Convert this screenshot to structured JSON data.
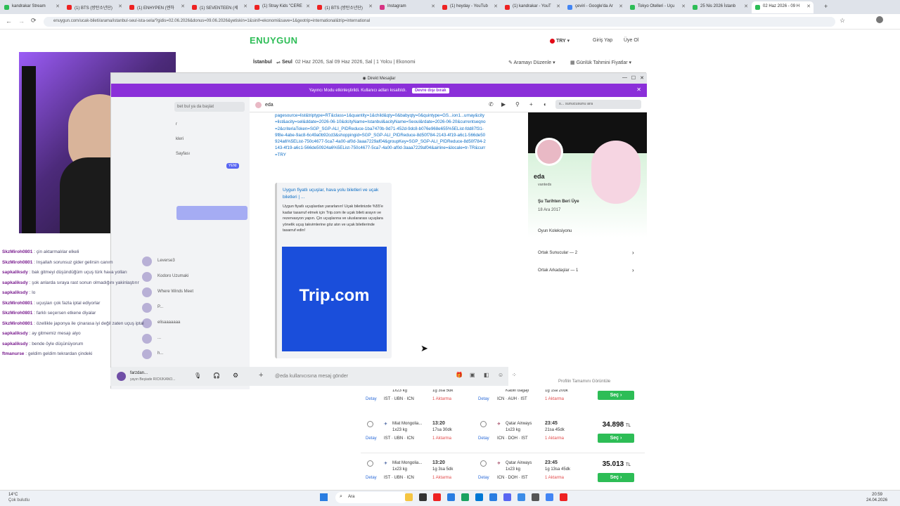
{
  "browser": {
    "tabs": [
      {
        "label": "kandrakar Stream",
        "color": "#2dbd56"
      },
      {
        "label": "(1) BTS (방탄소년단)",
        "color": "#e22"
      },
      {
        "label": "(1) ENHYPEN (엔하",
        "color": "#e22"
      },
      {
        "label": "(1) SEVENTEEN (세",
        "color": "#e22"
      },
      {
        "label": "(1) Stray Kids \"CERE",
        "color": "#e22"
      },
      {
        "label": "(1) BTS (방탄소년단)",
        "color": "#e22"
      },
      {
        "label": "Instagram",
        "color": "#d63384"
      },
      {
        "label": "(1) heyday - YouTub",
        "color": "#e22"
      },
      {
        "label": "(1) kandrakar - YouT",
        "color": "#e22"
      },
      {
        "label": "çeviri - Google'da Ar",
        "color": "#4285f4"
      },
      {
        "label": "Tokyo Otelleri - Uçu",
        "color": "#2dbd56"
      },
      {
        "label": "25 Nis 2026 İstanb",
        "color": "#2dbd56"
      },
      {
        "label": "02 Haz 2026 - 09 H",
        "color": "#2dbd56"
      }
    ],
    "url": "enuygun.com/ucak-bileti/arama/istanbul-seul-ista-sela/?gidis=02.06.2026&donus=09.06.2026&yetiskin=1&sinif=ekonomi&save=1&geotrip=international&trip=international"
  },
  "site": {
    "logo": "ENUYGUN",
    "currency": "TRY",
    "login": "Giriş Yap",
    "signup": "Üye Ol",
    "summary_from": "İstanbul",
    "summary_to": "Seul",
    "summary_details": "02 Haz 2026, Sal 09 Haz 2026, Sal | 1 Yolcu | Ekonomi",
    "edit_search": "Aramayı Düzenle",
    "daily_prices": "Günlük Tahmini Fiyatlar",
    "flights": [
      {
        "airline": "",
        "time": "",
        "bag": "1x23 kg",
        "duration": "1g 3sa 5dk",
        "route": "IST · UBN · ICN",
        "stops": "1 Aktarma",
        "ret_airline": "",
        "ret_time": "",
        "ret_bag": "Kabin bagajı",
        "ret_duration": "1g 1sa 20dk",
        "ret_route": "ICN · AUH · IST",
        "ret_stops": "1 Aktarma",
        "price": "",
        "btn": "Seç"
      },
      {
        "airline": "Miat Mongolia...",
        "time": "13:20",
        "bag": "1x23 kg",
        "duration": "17sa 30dk",
        "route": "IST · UBN · ICN",
        "stops": "1 Aktarma",
        "ret_airline": "Qatar Airways",
        "ret_time": "23:45",
        "ret_bag": "1x23 kg",
        "ret_duration": "21sa 45dk",
        "ret_route": "ICN · DOH · IST",
        "ret_stops": "1 Aktarma",
        "price": "34.898",
        "btn": "Seç"
      },
      {
        "airline": "Miat Mongolia...",
        "time": "13:20",
        "bag": "1x23 kg",
        "duration": "1g 3sa 5dk",
        "route": "IST · UBN · ICN",
        "stops": "1 Aktarma",
        "ret_airline": "Qatar Airways",
        "ret_time": "23:45",
        "ret_bag": "1x23 kg",
        "ret_duration": "1g 13sa 45dk",
        "ret_route": "ICN · DOH · IST",
        "ret_stops": "1 Aktarma",
        "price": "35.013",
        "btn": "Seç"
      }
    ],
    "detail_link": "Detay",
    "currency_suffix": "TL"
  },
  "discord": {
    "window_title": "Direkt Mesajlar",
    "banner_text": "Yayıncı Modu etkinleştirildi. Kullanıcı adları kısaltıldı.",
    "banner_button": "Devre dışı bırak",
    "dm_search": "bet bul ya da başlat",
    "new_badge": "YENİ",
    "dm_items": [
      "r",
      "kleri",
      "Sayfası",
      "Leverse3",
      "Kodoro Uzumaki",
      "Where Winds Meet",
      "P...",
      "elisaaaaaaa",
      "...",
      "h..."
    ],
    "channel_user": "eda",
    "search_placeholder": "s... sunucusunu ara",
    "link_text": "pagesource=list&triptype=RT&class=1&quantity=1&child&qty=0&babyqty=0&quintype=GS...ion1...urnay&city=list&acity=sel&ddate=2026-06-10&dcityName=Istanbul&acityName=Seoul&rdate=2026-06-20&currentseqno=2&criteriaToken=SGP_SGP-ALI_PIDReduce-1ba7470b-9d71-452d-9dc8-b076e968e655%5EList-fdd87f31-9f8e-4abe-9ac8-6c49a0b92cd3&shoppingid=SGP_SGP-ALI_PIDReduce-8d50f784-2143-4f19-a6c1-566de50924a6%5EList-750c4677-5ca7-4a00-af0d-3aaa7229af04&groupKey=SGP_SGP-ALI_PIDReduce-8d50f784-2143-4f19-a6c1-566de50924a6%5EList-750c4677-5ca7-4a00-af0d-3aaa7229af04&airline=&locale=tr-TR&curr=TRY",
    "embed_title": "Uygun fiyatlı uçuşlar, hava yolu biletleri ve uçak biletleri | ...",
    "embed_desc": "Uygun fiyatlı uçuşlardan yararlanın! Uçak biletinizde %55'e kadar tasarruf etmek için Trip.com ile uçak bileti arayın ve rezervasyon yapın. Çin uçuşlarına ve uluslararası uçuşlara yönelik uçuş takvimlerine göz atın ve uçak biletlerinde tasarruf edin!",
    "embed_brand": "Trip.com",
    "message_placeholder": "@eda kullanıcısına mesaj gönder",
    "profile": {
      "name": "eda",
      "status": "vanteds",
      "member_since_label": "Şu Tarihten Beri Üye",
      "member_since": "18 Ara 2017",
      "collection": "Oyun Koleksiyonu",
      "mutual_servers": "Ortak Sunucular — 2",
      "mutual_friends": "Ortak Arkadaşlar — 1",
      "view_full": "Profilin Tamamını Görüntüle"
    },
    "voice_user": "farzdan...",
    "voice_status": "yayın Beşiade RICK/KANO..."
  },
  "overlay_chat": [
    {
      "user": "SkzMiroh0801",
      "text": ": çin aktarmalılar elkeli"
    },
    {
      "user": "SkzMiroh0801",
      "text": ": Inşallah sorunsuz gider gelirsin canım"
    },
    {
      "user": "sapkaliksdy",
      "text": ": bak gitmeyi düşündüğüm uçuş türk hava yolları"
    },
    {
      "user": "sapkaliksdy",
      "text": ": şok anlarda sıraya rast sonun olmadığını yakinlaştırır"
    },
    {
      "user": "sapkaliksdy",
      "text": ": lo"
    },
    {
      "user": "SkzMiroh0801",
      "text": ": uçuşları çok fazla iptal ediyorlar"
    },
    {
      "user": "SkzMiroh0801",
      "text": ": farklı seçersen etkene diyalar"
    },
    {
      "user": "SkzMiroh0801",
      "text": ": özellikle japonya ile çinarasa iyi değil zaten uçuş iptal"
    },
    {
      "user": "sapkaliksdy",
      "text": ": ay gitmemiz mesajı alyo"
    },
    {
      "user": "sapkaliksdy",
      "text": ": bende öyle düşünüyorum"
    },
    {
      "user": "ftmanurse",
      "text": ": geldim geldim tekrardan çindeki"
    }
  ],
  "taskbar": {
    "weather_temp": "14°C",
    "weather_text": "Çok bulutlu",
    "search": "Ara",
    "time": "20:59",
    "date": "24.04.2026"
  }
}
